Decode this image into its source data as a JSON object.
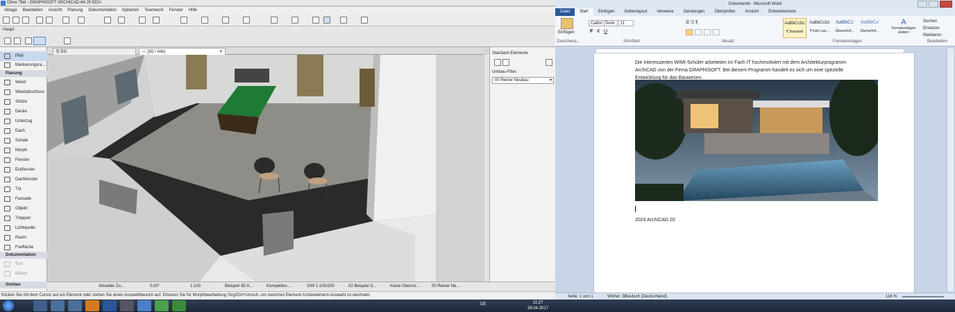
{
  "archicad": {
    "title": "Ohne Titel - GRAPHISOFT ARCHICAD-64 20 EDU",
    "menu": [
      "Ablage",
      "Bearbeiten",
      "Ansicht",
      "Planung",
      "Dokumentation",
      "Optionen",
      "Teamwork",
      "Fenster",
      "Hilfe"
    ],
    "haupt_label": "Haupt:",
    "tabs": [
      "EG",
      "[3D / Alle]"
    ],
    "tab_prefixes": [
      "⎘ ",
      "▭ "
    ],
    "toolbox": {
      "pfeil": "Pfeil",
      "markierung": "Markierungsra...",
      "planung_header": "Planung",
      "planung": [
        "Wand",
        "Wandabschluss",
        "Stütze",
        "Decke",
        "Unterzug",
        "Dach",
        "Schale",
        "Morph",
        "Fenster",
        "Eckfenster",
        "Dachfenster",
        "Tür",
        "Fassade",
        "Objekt",
        "Treppen",
        "Lichtquelle",
        "Raum",
        "Freifläche"
      ],
      "doku_header": "Dokumentation",
      "doku": [
        "Text",
        "Etikett"
      ],
      "sichten": "Sichten"
    },
    "info": {
      "title": "Standard-Elemente",
      "filter_label": "Umbau-Filter:",
      "filter_value": "00 Reiner Neubau"
    },
    "status": {
      "zoom": "Aktueller Zo...",
      "angle": "0,00°",
      "scale": "1:100",
      "view": "Beispiel 3D K...",
      "complete": "Komplettes ...",
      "layer": "S/W 1:100/200",
      "example": "02 Beispiel G...",
      "none": "Keine Überscr...",
      "phase": "00 Reiner Ne..."
    },
    "message": "Klicken Sie mit dem Cursor auf ein Element oder ziehen Sie einen Auswahlbereich auf. Drücken Sie für Morphbearbeitung Strg/Ctrl+Umsch, um zwischen Element-/Unterelement-Auswahl zu wechseln."
  },
  "word": {
    "title": "Dokument4 - Microsoft Word",
    "tabs": [
      "Datei",
      "Start",
      "Einfügen",
      "Seitenlayout",
      "Verweise",
      "Sendungen",
      "Überprüfen",
      "Ansicht",
      "Entwicklertools"
    ],
    "ribbon": {
      "paste": "Einfügen",
      "font": "Calibri (Textk",
      "size": "11",
      "styles": [
        {
          "preview": "AaBbCcDc",
          "name": "¶ Standard"
        },
        {
          "preview": "AaBbCcDc",
          "name": "¶ Kein Lee..."
        },
        {
          "preview": "AaBbCc",
          "name": "Überschrif..."
        },
        {
          "preview": "AaBbCc",
          "name": "Überschrif..."
        }
      ],
      "change_styles": "Formatvorlagen ändern",
      "search": "Suchen",
      "replace": "Ersetzen",
      "select": "Markieren",
      "groups": [
        "Zwischena...",
        "Schriftart",
        "Absatz",
        "Formatvorlagen",
        "Bearbeiten"
      ]
    },
    "doc": {
      "line1": "Die interessierten WIMI-Schüler arbeiteten im Fach IT hochmotiviert mit dem Architekturprogramm",
      "line2": "ArchiCAD von der Firma GRAPHISOFT. Bei diesem Programm handelt es sich um eine spezielle",
      "line3": "Entwicklung für das Bauwesen.",
      "caption_year": "2016",
      "caption_rest": " ArchiCAD 20"
    },
    "status": {
      "page": "Seite: 1 von 1",
      "words": "Wörter: 32",
      "language": "Deutsch (Deutschland)",
      "zoom": "116 %"
    }
  },
  "taskbar": {
    "lang": "DE",
    "time": "11:27",
    "date": "26.04.2017"
  },
  "colors": {
    "word_blue": "#2b579a",
    "archicad_sel": "#2c6fbf"
  }
}
